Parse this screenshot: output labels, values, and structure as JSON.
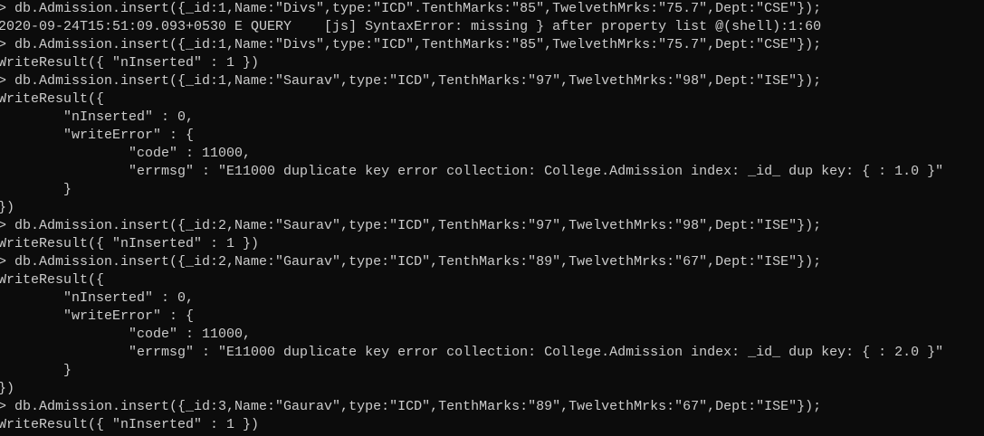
{
  "terminal": {
    "colors": {
      "background": "#0c0c0c",
      "foreground": "#cccccc"
    },
    "lines": [
      "> db.Admission.insert({_id:1,Name:\"Divs\",type:\"ICD\".TenthMarks:\"85\",TwelvethMrks:\"75.7\",Dept:\"CSE\"});",
      "2020-09-24T15:51:09.093+0530 E QUERY    [js] SyntaxError: missing } after property list @(shell):1:60",
      "> db.Admission.insert({_id:1,Name:\"Divs\",type:\"ICD\",TenthMarks:\"85\",TwelvethMrks:\"75.7\",Dept:\"CSE\"});",
      "WriteResult({ \"nInserted\" : 1 })",
      "> db.Admission.insert({_id:1,Name:\"Saurav\",type:\"ICD\",TenthMarks:\"97\",TwelvethMrks:\"98\",Dept:\"ISE\"});",
      "WriteResult({",
      "        \"nInserted\" : 0,",
      "        \"writeError\" : {",
      "                \"code\" : 11000,",
      "                \"errmsg\" : \"E11000 duplicate key error collection: College.Admission index: _id_ dup key: { : 1.0 }\"",
      "        }",
      "})",
      "> db.Admission.insert({_id:2,Name:\"Saurav\",type:\"ICD\",TenthMarks:\"97\",TwelvethMrks:\"98\",Dept:\"ISE\"});",
      "WriteResult({ \"nInserted\" : 1 })",
      "> db.Admission.insert({_id:2,Name:\"Gaurav\",type:\"ICD\",TenthMarks:\"89\",TwelvethMrks:\"67\",Dept:\"ISE\"});",
      "WriteResult({",
      "        \"nInserted\" : 0,",
      "        \"writeError\" : {",
      "                \"code\" : 11000,",
      "                \"errmsg\" : \"E11000 duplicate key error collection: College.Admission index: _id_ dup key: { : 2.0 }\"",
      "        }",
      "})",
      "> db.Admission.insert({_id:3,Name:\"Gaurav\",type:\"ICD\",TenthMarks:\"89\",TwelvethMrks:\"67\",Dept:\"ISE\"});",
      "WriteResult({ \"nInserted\" : 1 })"
    ]
  }
}
